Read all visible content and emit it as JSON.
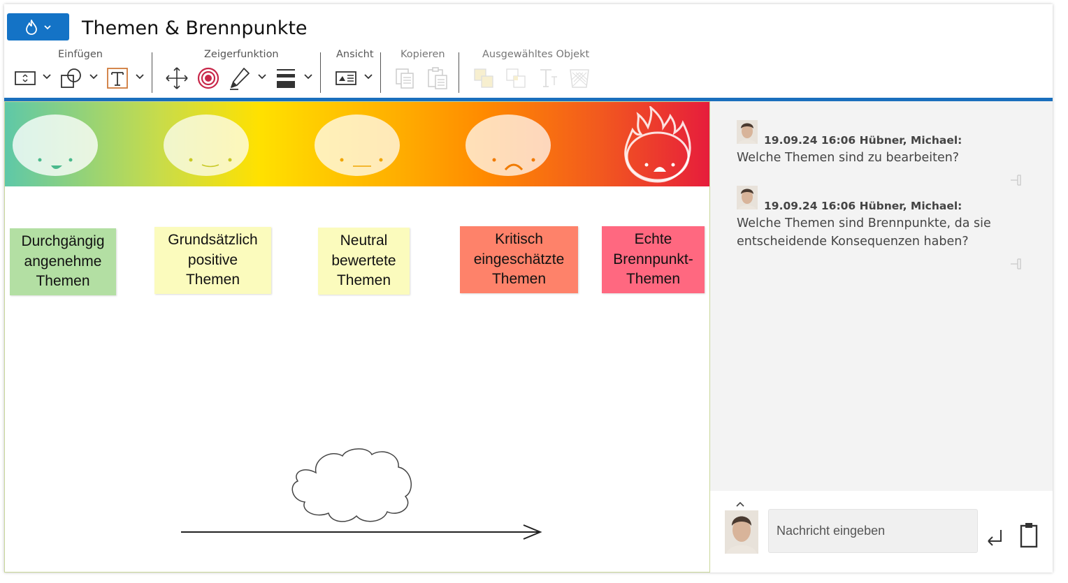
{
  "header": {
    "title": "Themen & Brennpunkte"
  },
  "ribbon": {
    "groups": [
      {
        "label": "Einfügen"
      },
      {
        "label": "Zeigerfunktion"
      },
      {
        "label": "Ansicht"
      },
      {
        "label": "Kopieren"
      },
      {
        "label": "Ausgewähltes Objekt"
      }
    ]
  },
  "colors": {
    "accent": "#1473c6",
    "note_green": "#b3dfa3",
    "note_yellow": "#fbfbbd",
    "note_orange": "#fe826a",
    "note_red": "#ff6880"
  },
  "board": {
    "notes": [
      {
        "text": "Durchgängig\nangenehme\nThemen"
      },
      {
        "text": "Grundsätzlich\npositive\nThemen"
      },
      {
        "text": "Neutral\nbewertete\nThemen"
      },
      {
        "text": "Kritisch\neingeschätzte\nThemen"
      },
      {
        "text": "Echte\nBrennpunkt-\nThemen"
      }
    ]
  },
  "chat": {
    "messages": [
      {
        "meta": "19.09.24 16:06 Hübner, Michael:",
        "text": "Welche Themen sind zu bearbeiten?"
      },
      {
        "meta": "19.09.24 16:06 Hübner, Michael:",
        "text": "Welche Themen sind Brennpunkte, da sie entscheidende Konsequenzen haben?"
      }
    ],
    "input_placeholder": "Nachricht eingeben"
  },
  "icons": [
    "flame-icon",
    "chevron-down-icon",
    "insert-frame-icon",
    "shapes-icon",
    "text-icon",
    "move-icon",
    "target-icon",
    "pen-icon",
    "line-weight-icon",
    "view-icon",
    "copy-icon",
    "paste-icon",
    "bring-front-icon",
    "send-back-icon",
    "text-format-icon",
    "delete-icon",
    "pin-icon",
    "send-icon",
    "clipboard-icon",
    "chevron-up-icon"
  ]
}
